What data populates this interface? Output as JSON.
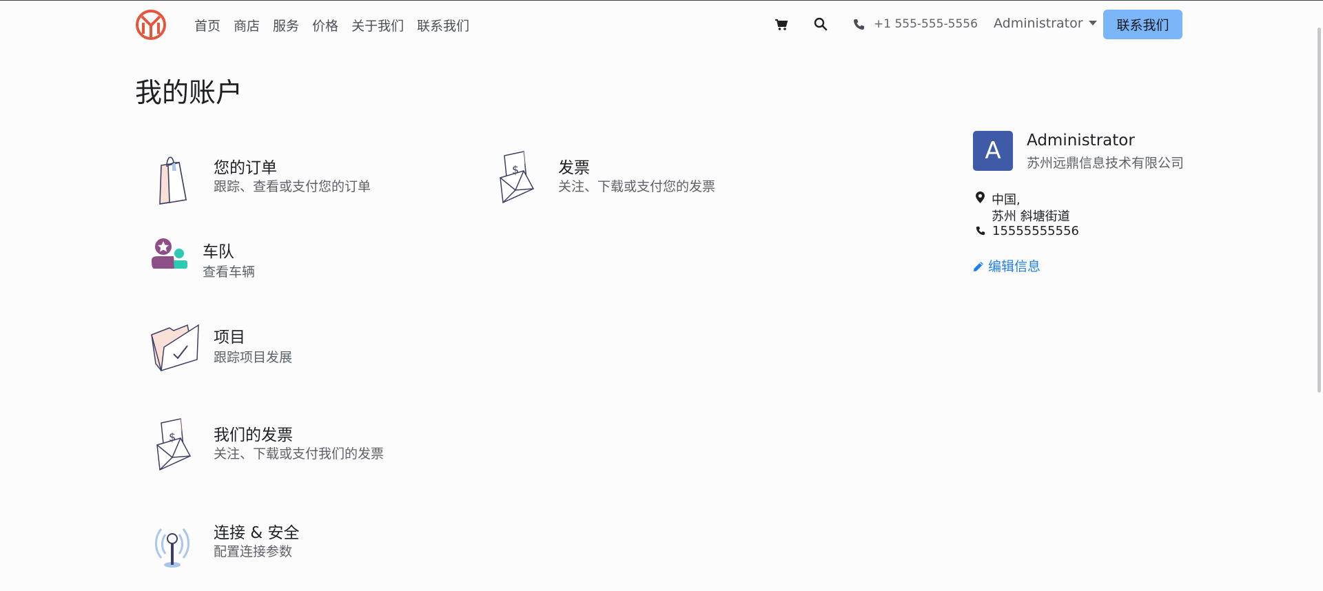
{
  "nav": {
    "items": [
      "首页",
      "商店",
      "服务",
      "价格",
      "关于我们",
      "联系我们"
    ],
    "phone": "+1 555-555-5556",
    "user": "Administrator",
    "cta": "联系我们"
  },
  "page": {
    "title": "我的账户"
  },
  "cards": {
    "orders": {
      "title": "您的订单",
      "desc": "跟踪、查看或支付您的订单"
    },
    "invoices": {
      "title": "发票",
      "desc": "关注、下载或支付您的发票"
    },
    "fleet": {
      "title": "车队",
      "desc": "查看车辆"
    },
    "projects": {
      "title": "项目",
      "desc": "跟踪项目发展"
    },
    "our_invoices": {
      "title": "我们的发票",
      "desc": "关注、下载或支付我们的发票"
    },
    "security": {
      "title": "连接 & 安全",
      "desc": "配置连接参数"
    }
  },
  "profile": {
    "avatar_letter": "A",
    "name": "Administrator",
    "company": "苏州远鼎信息技术有限公司",
    "address_line1": "中国,",
    "address_line2": "苏州 斜塘街道",
    "phone": "15555555556",
    "edit_label": "编辑信息"
  },
  "colors": {
    "brand_logo": "#e4573d",
    "cta_bg": "#7ab6f8",
    "avatar_bg": "#3f5aa6",
    "link": "#1f7ee8"
  }
}
